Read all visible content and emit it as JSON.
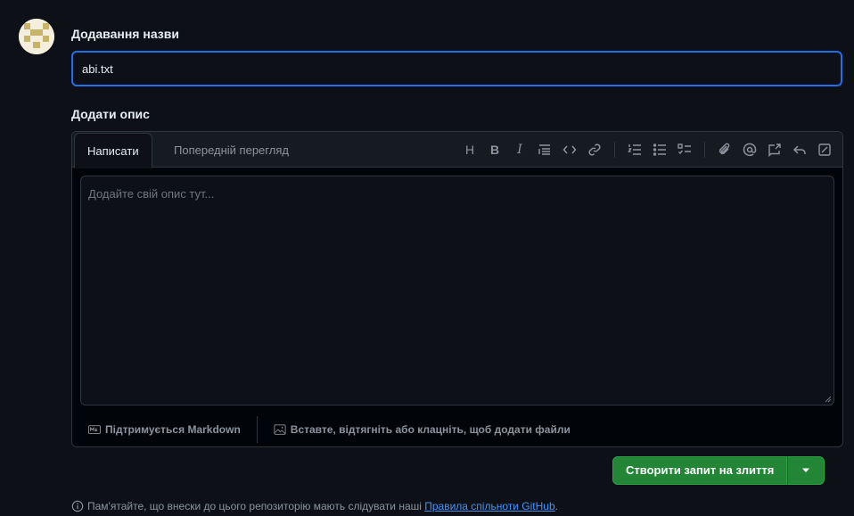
{
  "title_section": {
    "label": "Додавання назви",
    "value": "abi.txt"
  },
  "description_section": {
    "label": "Додати опис",
    "tabs": [
      "Написати",
      "Попередній перегляд"
    ],
    "placeholder": "Додайте свій опис тут...",
    "toolbar_text": {
      "heading": "H",
      "bold": "B",
      "italic": "I"
    },
    "markdown_note": "Підтримується Markdown",
    "attach_note": "Вставте, відтягніть або клацніть, щоб додати файли"
  },
  "submit": {
    "label": "Створити запит на злиття"
  },
  "notice": {
    "text": "Пам'ятайте, що внески до цього репозиторію мають слідувати наші",
    "link": "Правила спільноти GitHub",
    "suffix": "."
  },
  "colors": {
    "background": "#0d1117",
    "accent_border": "#1f6feb",
    "primary_button": "#238636",
    "link": "#4493f8"
  }
}
